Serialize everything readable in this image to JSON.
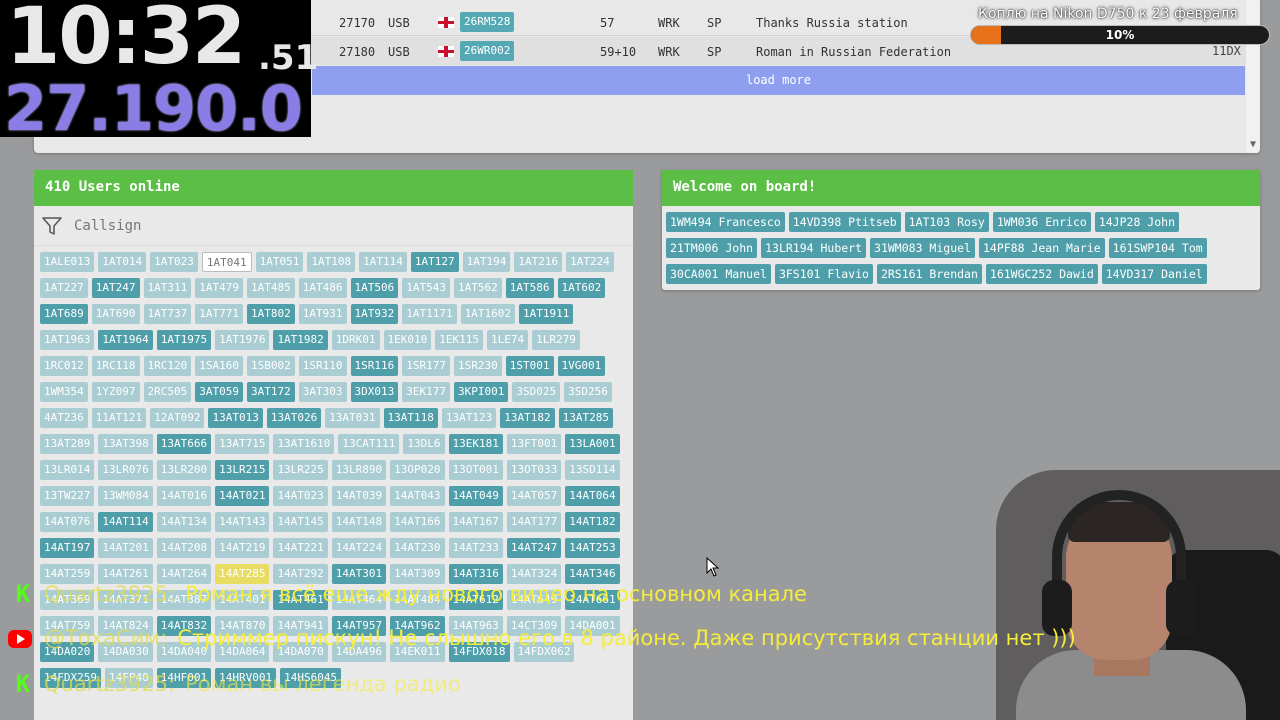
{
  "log": {
    "rows": [
      {
        "freq": "27170",
        "mode": "USB",
        "flag_icon": "england-flag-icon",
        "callsign": "26RM528",
        "rst": "57",
        "qth": "WRK",
        "prop": "SP",
        "comment": "Thanks Russia station"
      },
      {
        "freq": "27180",
        "mode": "USB",
        "flag_icon": "england-flag-icon",
        "callsign": "26WR002",
        "rst": "59+10",
        "qth": "WRK",
        "prop": "SP",
        "comment": "Roman in Russian Federation"
      }
    ],
    "load_more": "load more",
    "side_call": "11DX"
  },
  "clock": {
    "time": "10:32",
    "ms": ".51",
    "freq": "27.190.0"
  },
  "donation": {
    "title": "Коплю на Nikon D750 к 23 февраля",
    "percent_label": "10%",
    "progress": 0.1,
    "fill_color": "#e8721a"
  },
  "users": {
    "title": "410 Users online",
    "filter_placeholder": "Callsign",
    "chips": [
      {
        "t": "1ALE013",
        "s": "c1"
      },
      {
        "t": "1AT014",
        "s": "c1"
      },
      {
        "t": "1AT023",
        "s": "c1"
      },
      {
        "t": "1AT041",
        "s": "c4"
      },
      {
        "t": "1AT051",
        "s": "c1"
      },
      {
        "t": "1AT108",
        "s": "c1"
      },
      {
        "t": "1AT114",
        "s": "c1"
      },
      {
        "t": "1AT127",
        "s": "c3"
      },
      {
        "t": "1AT194",
        "s": "c1"
      },
      {
        "t": "1AT216",
        "s": "c1"
      },
      {
        "t": "1AT224",
        "s": "c1"
      },
      {
        "t": "1AT227",
        "s": "c1"
      },
      {
        "t": "1AT247",
        "s": "c3"
      },
      {
        "t": "1AT311",
        "s": "c1"
      },
      {
        "t": "1AT479",
        "s": "c1"
      },
      {
        "t": "1AT485",
        "s": "c1"
      },
      {
        "t": "1AT486",
        "s": "c1"
      },
      {
        "t": "1AT506",
        "s": "c3"
      },
      {
        "t": "1AT543",
        "s": "c1"
      },
      {
        "t": "1AT562",
        "s": "c1"
      },
      {
        "t": "1AT586",
        "s": "c3"
      },
      {
        "t": "1AT602",
        "s": "c3"
      },
      {
        "t": "1AT689",
        "s": "c3"
      },
      {
        "t": "1AT690",
        "s": "c1"
      },
      {
        "t": "1AT737",
        "s": "c1"
      },
      {
        "t": "1AT771",
        "s": "c1"
      },
      {
        "t": "1AT802",
        "s": "c3"
      },
      {
        "t": "1AT931",
        "s": "c1"
      },
      {
        "t": "1AT932",
        "s": "c3"
      },
      {
        "t": "1AT1171",
        "s": "c1"
      },
      {
        "t": "1AT1602",
        "s": "c1"
      },
      {
        "t": "1AT1911",
        "s": "c3"
      },
      {
        "t": "1AT1963",
        "s": "c1"
      },
      {
        "t": "1AT1964",
        "s": "c3"
      },
      {
        "t": "1AT1975",
        "s": "c3"
      },
      {
        "t": "1AT1976",
        "s": "c1"
      },
      {
        "t": "1AT1982",
        "s": "c3"
      },
      {
        "t": "1DRK01",
        "s": "c1"
      },
      {
        "t": "1EK010",
        "s": "c1"
      },
      {
        "t": "1EK115",
        "s": "c1"
      },
      {
        "t": "1LE74",
        "s": "c1"
      },
      {
        "t": "1LR279",
        "s": "c1"
      },
      {
        "t": "1RC012",
        "s": "c1"
      },
      {
        "t": "1RC118",
        "s": "c1"
      },
      {
        "t": "1RC120",
        "s": "c1"
      },
      {
        "t": "1SA160",
        "s": "c1"
      },
      {
        "t": "1SB002",
        "s": "c1"
      },
      {
        "t": "1SR110",
        "s": "c1"
      },
      {
        "t": "1SR116",
        "s": "c3"
      },
      {
        "t": "1SR177",
        "s": "c1"
      },
      {
        "t": "1SR230",
        "s": "c1"
      },
      {
        "t": "1ST001",
        "s": "c3"
      },
      {
        "t": "1VG001",
        "s": "c3"
      },
      {
        "t": "1WM354",
        "s": "c1"
      },
      {
        "t": "1YZ097",
        "s": "c1"
      },
      {
        "t": "2RC505",
        "s": "c1"
      },
      {
        "t": "3AT059",
        "s": "c3"
      },
      {
        "t": "3AT172",
        "s": "c3"
      },
      {
        "t": "3AT303",
        "s": "c1"
      },
      {
        "t": "3DX013",
        "s": "c3"
      },
      {
        "t": "3EK177",
        "s": "c1"
      },
      {
        "t": "3KPI001",
        "s": "c3"
      },
      {
        "t": "3SD025",
        "s": "c1"
      },
      {
        "t": "3SD256",
        "s": "c1"
      },
      {
        "t": "4AT236",
        "s": "c1"
      },
      {
        "t": "11AT121",
        "s": "c1"
      },
      {
        "t": "12AT092",
        "s": "c1"
      },
      {
        "t": "13AT013",
        "s": "c3"
      },
      {
        "t": "13AT026",
        "s": "c3"
      },
      {
        "t": "13AT031",
        "s": "c1"
      },
      {
        "t": "13AT118",
        "s": "c3"
      },
      {
        "t": "13AT123",
        "s": "c1"
      },
      {
        "t": "13AT182",
        "s": "c3"
      },
      {
        "t": "13AT285",
        "s": "c3"
      },
      {
        "t": "13AT289",
        "s": "c1"
      },
      {
        "t": "13AT398",
        "s": "c1"
      },
      {
        "t": "13AT666",
        "s": "c3"
      },
      {
        "t": "13AT715",
        "s": "c1"
      },
      {
        "t": "13AT1610",
        "s": "c1"
      },
      {
        "t": "13CAT111",
        "s": "c1"
      },
      {
        "t": "13DL6",
        "s": "c1"
      },
      {
        "t": "13EK181",
        "s": "c3"
      },
      {
        "t": "13FT001",
        "s": "c1"
      },
      {
        "t": "13LA001",
        "s": "c3"
      },
      {
        "t": "13LR014",
        "s": "c1"
      },
      {
        "t": "13LR076",
        "s": "c1"
      },
      {
        "t": "13LR200",
        "s": "c1"
      },
      {
        "t": "13LR215",
        "s": "c3"
      },
      {
        "t": "13LR225",
        "s": "c1"
      },
      {
        "t": "13LR890",
        "s": "c1"
      },
      {
        "t": "13OP020",
        "s": "c1"
      },
      {
        "t": "13OT001",
        "s": "c1"
      },
      {
        "t": "13OT033",
        "s": "c1"
      },
      {
        "t": "13SD114",
        "s": "c1"
      },
      {
        "t": "13TW227",
        "s": "c1"
      },
      {
        "t": "13WM084",
        "s": "c1"
      },
      {
        "t": "14AT016",
        "s": "c1"
      },
      {
        "t": "14AT021",
        "s": "c3"
      },
      {
        "t": "14AT023",
        "s": "c1"
      },
      {
        "t": "14AT039",
        "s": "c1"
      },
      {
        "t": "14AT043",
        "s": "c1"
      },
      {
        "t": "14AT049",
        "s": "c3"
      },
      {
        "t": "14AT057",
        "s": "c1"
      },
      {
        "t": "14AT064",
        "s": "c3"
      },
      {
        "t": "14AT076",
        "s": "c1"
      },
      {
        "t": "14AT114",
        "s": "c3"
      },
      {
        "t": "14AT134",
        "s": "c1"
      },
      {
        "t": "14AT143",
        "s": "c1"
      },
      {
        "t": "14AT145",
        "s": "c1"
      },
      {
        "t": "14AT148",
        "s": "c1"
      },
      {
        "t": "14AT166",
        "s": "c1"
      },
      {
        "t": "14AT167",
        "s": "c1"
      },
      {
        "t": "14AT177",
        "s": "c1"
      },
      {
        "t": "14AT182",
        "s": "c3"
      },
      {
        "t": "14AT197",
        "s": "c3"
      },
      {
        "t": "14AT201",
        "s": "c1"
      },
      {
        "t": "14AT208",
        "s": "c1"
      },
      {
        "t": "14AT219",
        "s": "c1"
      },
      {
        "t": "14AT221",
        "s": "c1"
      },
      {
        "t": "14AT224",
        "s": "c1"
      },
      {
        "t": "14AT230",
        "s": "c1"
      },
      {
        "t": "14AT233",
        "s": "c1"
      },
      {
        "t": "14AT247",
        "s": "c3"
      },
      {
        "t": "14AT253",
        "s": "c3"
      },
      {
        "t": "14AT259",
        "s": "c1"
      },
      {
        "t": "14AT261",
        "s": "c1"
      },
      {
        "t": "14AT264",
        "s": "c1"
      },
      {
        "t": "14AT285",
        "s": "c5"
      },
      {
        "t": "14AT292",
        "s": "c1"
      },
      {
        "t": "14AT301",
        "s": "c3"
      },
      {
        "t": "14AT309",
        "s": "c1"
      },
      {
        "t": "14AT316",
        "s": "c3"
      },
      {
        "t": "14AT324",
        "s": "c1"
      },
      {
        "t": "14AT346",
        "s": "c3"
      },
      {
        "t": "14AT369",
        "s": "c1"
      },
      {
        "t": "14AT371",
        "s": "c1"
      },
      {
        "t": "14AT387",
        "s": "c1"
      },
      {
        "t": "14AT401",
        "s": "c1"
      },
      {
        "t": "14AT461",
        "s": "c3"
      },
      {
        "t": "14AT464",
        "s": "c1"
      },
      {
        "t": "14AT484",
        "s": "c1"
      },
      {
        "t": "14AT612",
        "s": "c3"
      },
      {
        "t": "14AT649",
        "s": "c1"
      },
      {
        "t": "14AT661",
        "s": "c3"
      },
      {
        "t": "14AT759",
        "s": "c1"
      },
      {
        "t": "14AT824",
        "s": "c1"
      },
      {
        "t": "14AT832",
        "s": "c3"
      },
      {
        "t": "14AT870",
        "s": "c1"
      },
      {
        "t": "14AT941",
        "s": "c1"
      },
      {
        "t": "14AT957",
        "s": "c3"
      },
      {
        "t": "14AT962",
        "s": "c3"
      },
      {
        "t": "14AT963",
        "s": "c1"
      },
      {
        "t": "14CT309",
        "s": "c1"
      },
      {
        "t": "14DA001",
        "s": "c1"
      },
      {
        "t": "14DA020",
        "s": "c3"
      },
      {
        "t": "14DA030",
        "s": "c1"
      },
      {
        "t": "14DA040",
        "s": "c1"
      },
      {
        "t": "14DA064",
        "s": "c1"
      },
      {
        "t": "14DA070",
        "s": "c1"
      },
      {
        "t": "14DA496",
        "s": "c1"
      },
      {
        "t": "14EK011",
        "s": "c1"
      },
      {
        "t": "14FDX018",
        "s": "c3"
      },
      {
        "t": "14FDX062",
        "s": "c1"
      },
      {
        "t": "14FDX259",
        "s": "c3"
      },
      {
        "t": "14FP40",
        "s": "c1"
      },
      {
        "t": "14HF001",
        "s": "c3"
      },
      {
        "t": "14HRV001",
        "s": "c3"
      },
      {
        "t": "14HS6045",
        "s": "c3"
      }
    ]
  },
  "welcome": {
    "title": "Welcome on board!",
    "chips": [
      "1WM494 Francesco",
      "14VD398 Ptitseb",
      "1AT103 Rosy",
      "1WM036 Enrico",
      "14JP28 John",
      "21TM006 John",
      "13LR194 Hubert",
      "31WM083 Miguel",
      "14PF88 Jean Marie",
      "161SWP104 Tom",
      "30CA001 Manuel",
      "3FS101 Flavio",
      "2RS161 Brendan",
      "161WGC252 Dawid",
      "14VD317 Daniel"
    ]
  },
  "chat": [
    {
      "platform_icon": "kick-icon",
      "user": "Quartz3925:",
      "message": "Роман я всё еще жду нового видео на основном канале",
      "dim": false
    },
    {
      "platform_icon": "youtube-icon",
      "user": "@ТохаСим:",
      "message": "Стриммер пискун! Не слышно его в 8 районе. Даже присутствия станции нет )))",
      "dim": false
    },
    {
      "platform_icon": "kick-icon",
      "user": "Quartz3925:",
      "message": "Роман вы легенда радио",
      "dim": true
    }
  ]
}
